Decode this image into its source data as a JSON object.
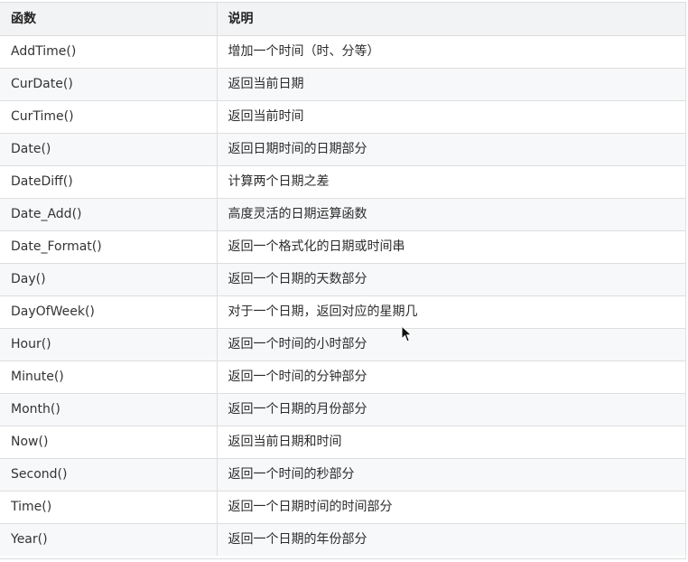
{
  "table": {
    "headers": [
      "函数",
      "说明"
    ],
    "rows": [
      {
        "fn": "AddTime()",
        "desc": "增加一个时间（时、分等）"
      },
      {
        "fn": "CurDate()",
        "desc": "返回当前日期"
      },
      {
        "fn": "CurTime()",
        "desc": "返回当前时间"
      },
      {
        "fn": "Date()",
        "desc": "返回日期时间的日期部分"
      },
      {
        "fn": "DateDiff()",
        "desc": "计算两个日期之差"
      },
      {
        "fn": "Date_Add()",
        "desc": "高度灵活的日期运算函数"
      },
      {
        "fn": "Date_Format()",
        "desc": "返回一个格式化的日期或时间串"
      },
      {
        "fn": "Day()",
        "desc": "返回一个日期的天数部分"
      },
      {
        "fn": "DayOfWeek()",
        "desc": "对于一个日期，返回对应的星期几"
      },
      {
        "fn": "Hour()",
        "desc": "返回一个时间的小时部分"
      },
      {
        "fn": "Minute()",
        "desc": "返回一个时间的分钟部分"
      },
      {
        "fn": "Month()",
        "desc": "返回一个日期的月份部分"
      },
      {
        "fn": "Now()",
        "desc": "返回当前日期和时间"
      },
      {
        "fn": "Second()",
        "desc": "返回一个时间的秒部分"
      },
      {
        "fn": "Time()",
        "desc": "返回一个日期时间的时间部分"
      },
      {
        "fn": "Year()",
        "desc": "返回一个日期的年份部分"
      }
    ]
  },
  "cursor": {
    "icon": "mouse-pointer-icon"
  }
}
